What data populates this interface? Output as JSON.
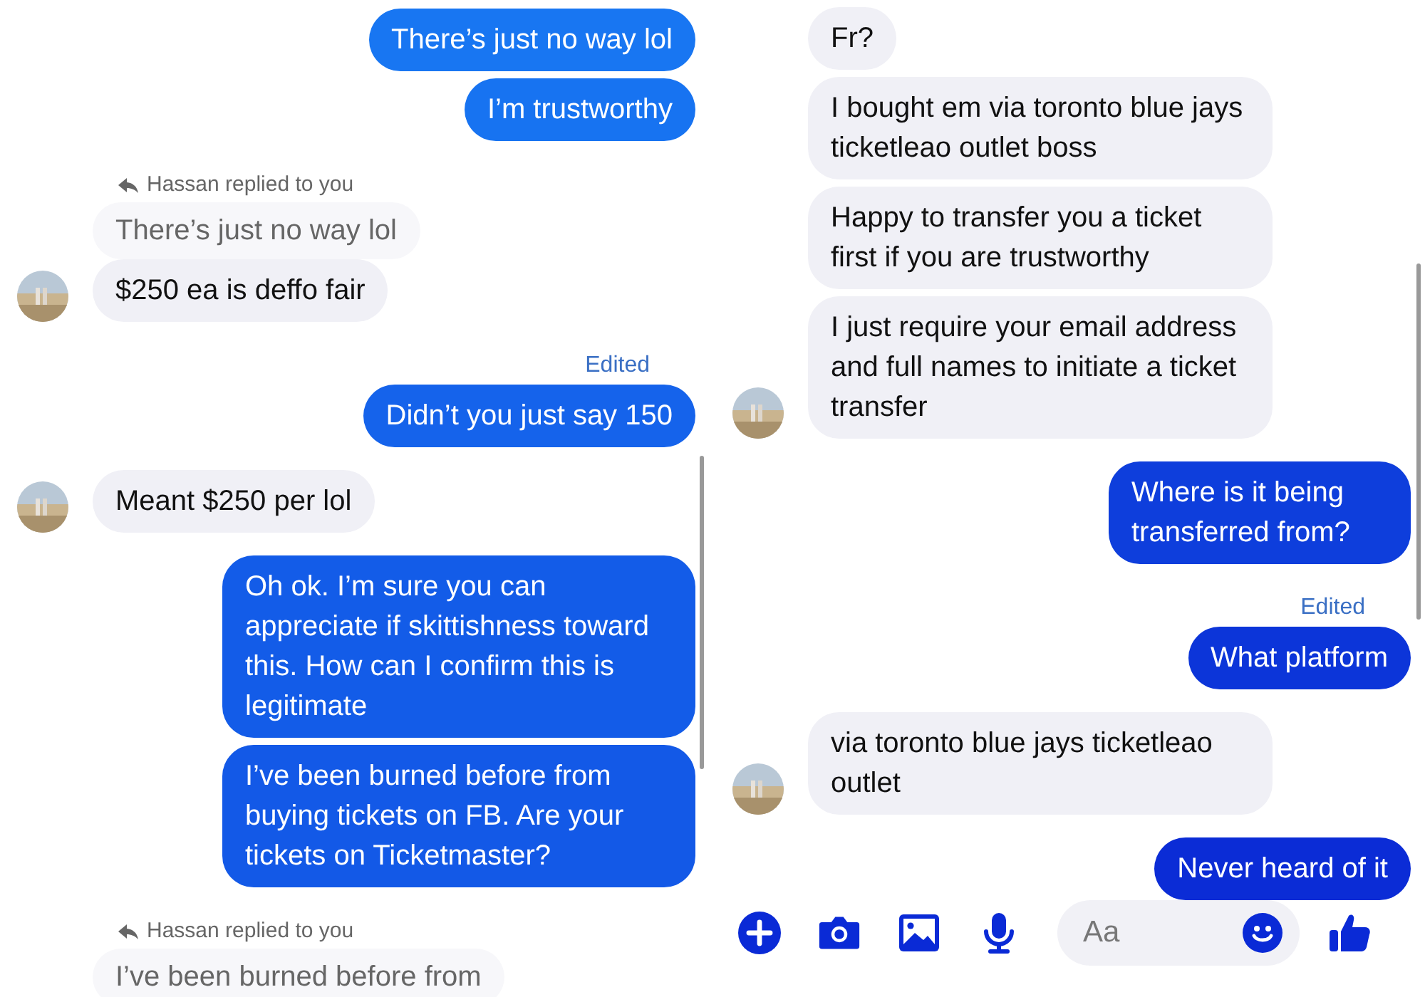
{
  "panels": [
    {
      "messages": [
        {
          "kind": "sent",
          "text": "There’s just no way lol"
        },
        {
          "kind": "sent",
          "text": "I’m trustworthy"
        },
        {
          "kind": "reply_label",
          "text": "Hassan replied to you"
        },
        {
          "kind": "quoted",
          "text": "There’s just no way lol"
        },
        {
          "kind": "received",
          "text": "$250 ea is deffo fair",
          "avatar": true
        },
        {
          "kind": "edited",
          "text": "Edited"
        },
        {
          "kind": "sent",
          "text": "Didn’t you just say 150"
        },
        {
          "kind": "received",
          "text": "Meant $250 per lol",
          "avatar": true
        },
        {
          "kind": "sent",
          "text": "Oh ok. I’m sure you can appreciate if skittishness toward this. How can I confirm this is legitimate"
        },
        {
          "kind": "sent",
          "text": "I’ve been burned before from buying tickets on FB. Are your tickets on Ticketmaster?"
        },
        {
          "kind": "reply_label",
          "text": "Hassan replied to you"
        },
        {
          "kind": "quoted",
          "text": "I’ve been burned before from"
        }
      ]
    },
    {
      "messages": [
        {
          "kind": "received",
          "text": "Fr?"
        },
        {
          "kind": "received",
          "text": "I bought em via toronto blue jays ticketleao outlet boss"
        },
        {
          "kind": "received",
          "text": "Happy to transfer you a ticket first if you are trustworthy"
        },
        {
          "kind": "received",
          "text": "I just require your email address and full names to initiate a ticket transfer",
          "avatar": true
        },
        {
          "kind": "sent",
          "text": "Where is it being transferred from?"
        },
        {
          "kind": "edited",
          "text": "Edited"
        },
        {
          "kind": "sent",
          "text": "What platform"
        },
        {
          "kind": "received",
          "text": "via toronto blue jays ticketleao outlet",
          "avatar": true
        },
        {
          "kind": "sent",
          "text": "Never heard of it"
        }
      ],
      "composer": {
        "placeholder": "Aa"
      }
    }
  ]
}
